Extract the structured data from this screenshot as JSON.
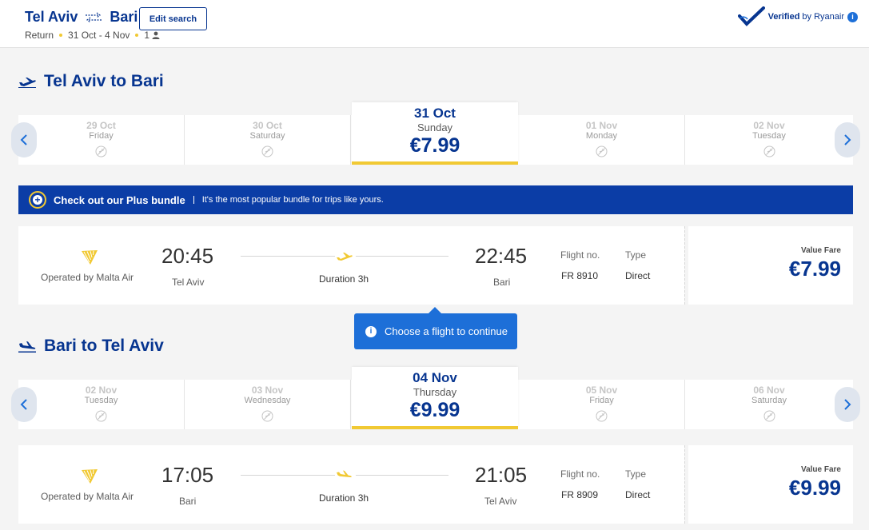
{
  "header": {
    "origin": "Tel Aviv",
    "destination": "Bari",
    "edit_label": "Edit search",
    "trip_type": "Return",
    "dates": "31 Oct - 4 Nov",
    "passengers": "1",
    "verified_label": "Verified",
    "verified_by": "by Ryanair",
    "info_glyph": "i"
  },
  "outbound": {
    "title": "Tel Aviv to Bari",
    "dates": [
      {
        "date": "29 Oct",
        "weekday": "Friday"
      },
      {
        "date": "30 Oct",
        "weekday": "Saturday"
      },
      {
        "date": "31 Oct",
        "weekday": "Sunday",
        "price": "€7.99",
        "selected": true
      },
      {
        "date": "01 Nov",
        "weekday": "Monday"
      },
      {
        "date": "02 Nov",
        "weekday": "Tuesday"
      }
    ],
    "flight": {
      "operated_by": "Operated by Malta Air",
      "departure_time": "20:45",
      "departure_city": "Tel Aviv",
      "duration": "Duration 3h",
      "arrival_time": "22:45",
      "arrival_city": "Bari",
      "flight_no_label": "Flight no.",
      "flight_no": "FR 8910",
      "type_label": "Type",
      "type": "Direct",
      "fare_label": "Value Fare",
      "fare_price": "€7.99"
    }
  },
  "promo": {
    "plus_glyph": "+",
    "title": "Check out our Plus bundle",
    "text": "It's the most popular bundle for trips like yours."
  },
  "tooltip": {
    "info_glyph": "i",
    "text": "Choose a flight to continue"
  },
  "inbound": {
    "title": "Bari to Tel Aviv",
    "dates": [
      {
        "date": "02 Nov",
        "weekday": "Tuesday"
      },
      {
        "date": "03 Nov",
        "weekday": "Wednesday"
      },
      {
        "date": "04 Nov",
        "weekday": "Thursday",
        "price": "€9.99",
        "selected": true
      },
      {
        "date": "05 Nov",
        "weekday": "Friday"
      },
      {
        "date": "06 Nov",
        "weekday": "Saturday"
      }
    ],
    "flight": {
      "operated_by": "Operated by Malta Air",
      "departure_time": "17:05",
      "departure_city": "Bari",
      "duration": "Duration 3h",
      "arrival_time": "21:05",
      "arrival_city": "Tel Aviv",
      "flight_no_label": "Flight no.",
      "flight_no": "FR 8909",
      "type_label": "Type",
      "type": "Direct",
      "fare_label": "Value Fare",
      "fare_price": "€9.99"
    }
  },
  "colors": {
    "brand_blue": "#073590",
    "accent_yellow": "#f1c933",
    "promo_blue": "#0b3da6",
    "tooltip_blue": "#1d6fd8"
  },
  "icons": {
    "route": "two-way-arrows-icon",
    "passenger": "person-icon",
    "verified": "verified-check-icon",
    "departure": "plane-takeoff-icon",
    "arrival": "plane-landing-icon",
    "no_flight": "no-flights-icon",
    "airline": "ryanair-harp-logo"
  }
}
